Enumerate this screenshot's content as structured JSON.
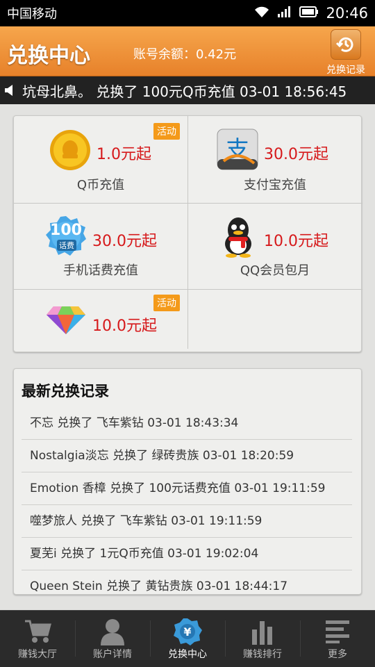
{
  "status_bar": {
    "carrier": "中国移动",
    "time": "20:46"
  },
  "header": {
    "title": "兑换中心",
    "balance": "账号余额：0.42元",
    "history_label": "兑换记录"
  },
  "ticker": {
    "text": "坑母北鼻。 兑换了 100元Q币充值 03-01 18:56:45"
  },
  "exchange_items": [
    {
      "name": "Q币充值",
      "price": "1.0元起",
      "badge": "活动",
      "icon": "q-coin-icon"
    },
    {
      "name": "支付宝充值",
      "price": "30.0元起",
      "badge": "",
      "icon": "alipay-icon"
    },
    {
      "name": "手机话费充值",
      "price": "30.0元起",
      "badge": "",
      "icon": "phone-credit-100-icon",
      "icon_text_top": "100",
      "icon_text_bottom": "话费"
    },
    {
      "name": "QQ会员包月",
      "price": "10.0元起",
      "badge": "",
      "icon": "qq-penguin-icon"
    },
    {
      "name": "",
      "price": "10.0元起",
      "badge": "活动",
      "icon": "diamond-icon"
    }
  ],
  "records": {
    "title": "最新兑换记录",
    "items": [
      "不忘 兑换了  飞车紫钻 03-01 18:43:34",
      "Nostalgia淡忘 兑换了  绿砖贵族 03-01 18:20:59",
      "Emotion 香樟 兑换了  100元话费充值 03-01 19:11:59",
      "噬梦旅人 兑换了  飞车紫钻 03-01 19:11:59",
      "夏芜i 兑换了  1元Q币充值 03-01 19:02:04",
      "Queen Stein 兑换了  黄钻贵族 03-01 18:44:17"
    ]
  },
  "bottom_nav": [
    {
      "label": "赚钱大厅",
      "icon": "cart-icon",
      "active": false
    },
    {
      "label": "账户详情",
      "icon": "user-icon",
      "active": false
    },
    {
      "label": "兑换中心",
      "icon": "yen-coin-icon",
      "active": true
    },
    {
      "label": "赚钱排行",
      "icon": "ranking-bars-icon",
      "active": false
    },
    {
      "label": "更多",
      "icon": "menu-lines-icon",
      "active": false
    }
  ],
  "colors": {
    "header_orange": "#e7812a",
    "price_red": "#d6191b",
    "badge_orange": "#f49a1a",
    "nav_active_blue": "#3a9ad9"
  }
}
